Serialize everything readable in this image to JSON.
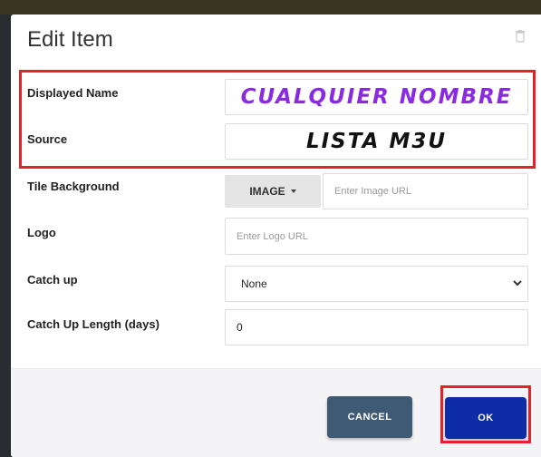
{
  "dialog": {
    "title": "Edit Item",
    "icon": "trash-icon"
  },
  "fields": {
    "displayed_name_label": "Displayed Name",
    "displayed_name_value": "CUALQUIER NOMBRE",
    "source_label": "Source",
    "source_value": "LISTA M3U",
    "tile_background_label": "Tile Background",
    "tile_background_type": "IMAGE",
    "image_url_placeholder": "Enter Image URL",
    "logo_label": "Logo",
    "logo_placeholder": "Enter Logo URL",
    "catch_up_label": "Catch up",
    "catch_up_value": "None",
    "catch_up_length_label": "Catch Up Length (days)",
    "catch_up_length_value": "0"
  },
  "buttons": {
    "cancel": "CANCEL",
    "ok": "OK"
  },
  "colors": {
    "highlight": "#e5222b",
    "displayed_name_text": "#8a2be2",
    "ok_button": "#0d2ca6",
    "cancel_button": "#3e5a74"
  }
}
